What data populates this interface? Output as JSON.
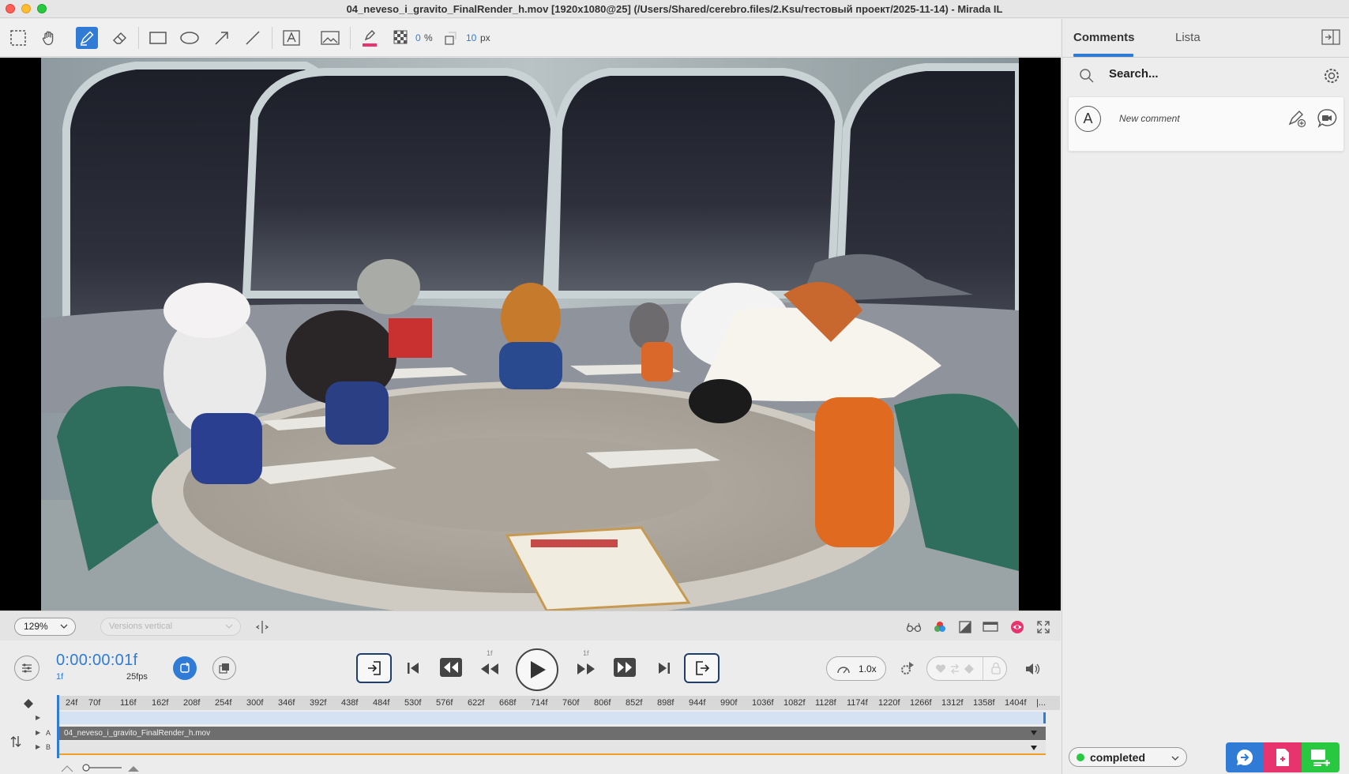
{
  "window": {
    "title": "04_neveso_i_gravito_FinalRender_h.mov [1920x1080@25] (/Users/Shared/cerebro.files/2.Ksu/тестовый проект/2025-11-14) - Mirada IL"
  },
  "toolbar": {
    "tools": [
      "select-tool",
      "hand-tool",
      "pen-tool",
      "eraser-tool",
      "rectangle-tool",
      "ellipse-tool",
      "arrow-tool",
      "line-tool",
      "text-tool",
      "image-tool",
      "color-tool",
      "grid-tool",
      "opacity-tool"
    ],
    "active_tool": "pen-tool",
    "color": "#e8346e",
    "opacity_value": "0",
    "opacity_unit": "%",
    "size_value": "10",
    "size_unit": "px"
  },
  "viewer": {
    "zoom": "129%",
    "versions_placeholder": "Versions vertical"
  },
  "transport": {
    "timecode": "0:00:00:01f",
    "frame": "1f",
    "fps": "25fps",
    "step_back_label": "1f",
    "step_forward_label": "1f",
    "speed": "1.0x"
  },
  "timeline": {
    "ruler_ticks": [
      "24f",
      "70f",
      "116f",
      "162f",
      "208f",
      "254f",
      "300f",
      "346f",
      "392f",
      "438f",
      "484f",
      "530f",
      "576f",
      "622f",
      "668f",
      "714f",
      "760f",
      "806f",
      "852f",
      "898f",
      "944f",
      "990f",
      "1036f",
      "1082f",
      "1128f",
      "1174f",
      "1220f",
      "1266f",
      "1312f",
      "1358f",
      "1404f",
      "|..."
    ],
    "track_a_label": "A",
    "track_b_label": "B",
    "clip_name": "04_neveso_i_gravito_FinalRender_h.mov"
  },
  "panel": {
    "tabs": [
      {
        "label": "Comments",
        "active": true
      },
      {
        "label": "Lista",
        "active": false
      }
    ],
    "search_placeholder": "Search...",
    "avatar_letter": "A",
    "new_comment_label": "New comment",
    "status": "completed",
    "status_color": "#28c840",
    "action_colors": {
      "comment": "#2f7bd6",
      "document": "#e8346e",
      "add": "#28c840"
    }
  }
}
